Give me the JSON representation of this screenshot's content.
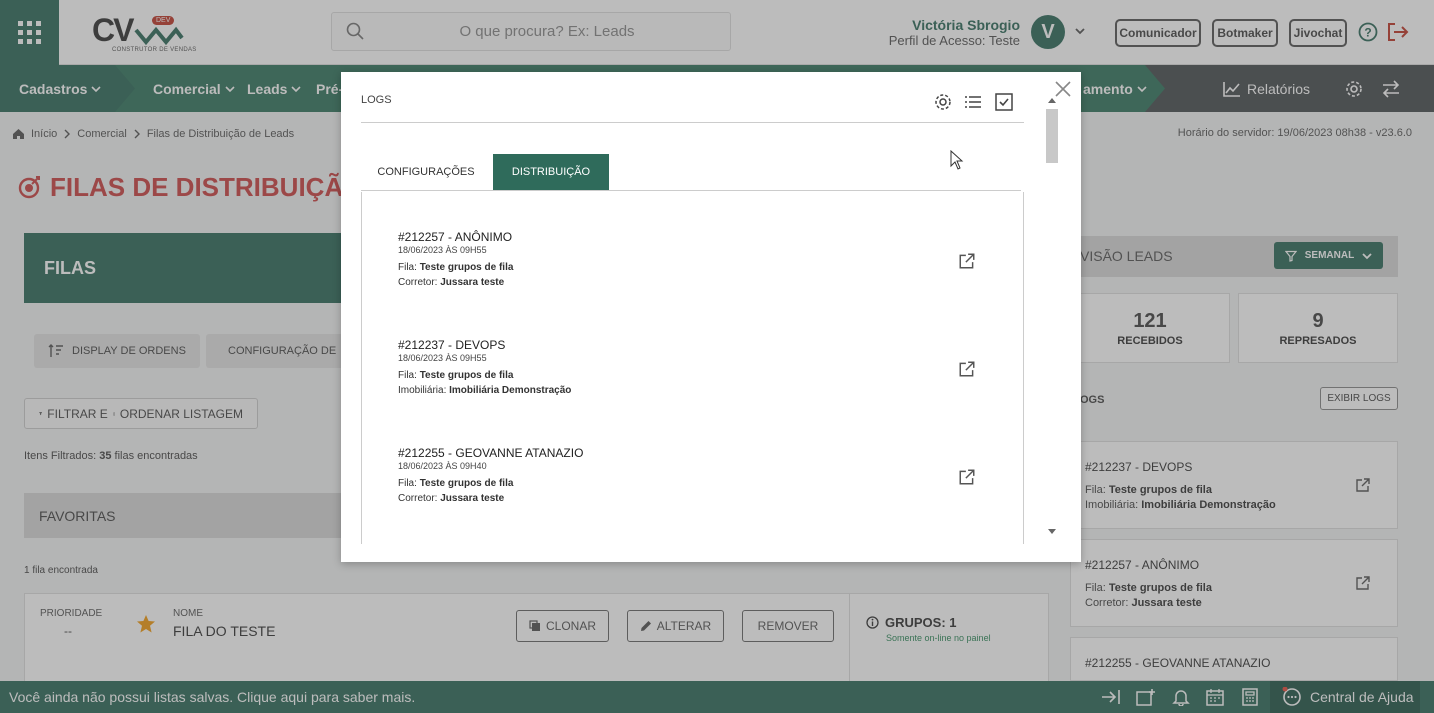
{
  "header": {
    "search_placeholder": "O que procura? Ex: Leads",
    "user_name": "Victória Sbrogio",
    "user_profile": "Perfil de Acesso: Teste",
    "avatar_letter": "V",
    "logo_text": "CV",
    "logo_badge": "DEV",
    "logo_tagline": "CONSTRUTOR DE VENDAS",
    "buttons": [
      "Comunicador",
      "Botmaker",
      "Jivochat"
    ]
  },
  "nav": {
    "items": [
      "Cadastros",
      "Comercial",
      "Leads",
      "Pré-",
      "amento"
    ],
    "relatorios": "Relatórios"
  },
  "breadcrumb": {
    "items": [
      "Início",
      "Comercial",
      "Filas de Distribuição de Leads"
    ],
    "server_time": "Horário do servidor: 19/06/2023 08h38 - v23.6.0"
  },
  "page": {
    "title": "FILAS DE DISTRIBUIÇÃ",
    "filas_label": "FILAS",
    "display_btn": "DISPLAY DE ORDENS",
    "config_btn": "CONFIGURAÇÃO DE",
    "filter_a": "FILTRAR E",
    "filter_b": "ORDENAR LISTAGEM",
    "items_prefix": "Itens Filtrados:",
    "items_count": "35",
    "items_suffix": "filas encontradas",
    "favoritas": "FAVORITAS",
    "one_found": "1 fila encontrada",
    "card": {
      "prioridade_label": "PRIORIDADE",
      "prioridade_value": "--",
      "nome_label": "NOME",
      "nome_value": "FILA DO TESTE",
      "clonar": "CLONAR",
      "alterar": "ALTERAR",
      "remover": "REMOVER",
      "grupos": "GRUPOS: 1",
      "grupos_sub": "Somente on-line no painel"
    }
  },
  "right_panel": {
    "visao": "VISÃO LEADS",
    "semanal": "SEMANAL",
    "stats": [
      {
        "value": "121",
        "label": "RECEBIDOS"
      },
      {
        "value": "9",
        "label": "REPRESADOS"
      }
    ],
    "logs_label": "OGS",
    "exibir_logs": "EXIBIR LOGS",
    "logs": [
      {
        "title": "#212237 - DEVOPS",
        "l1_label": "Fila:",
        "l1_value": "Teste grupos de fila",
        "l2_label": "Imobiliária:",
        "l2_value": "Imobiliária Demonstração"
      },
      {
        "title": "#212257 - ANÔNIMO",
        "l1_label": "Fila:",
        "l1_value": "Teste grupos de fila",
        "l2_label": "Corretor:",
        "l2_value": "Jussara teste"
      },
      {
        "title": "#212255 - GEOVANNE ATANAZIO"
      }
    ]
  },
  "footer": {
    "message": "Você ainda não possui listas salvas. Clique aqui para saber mais.",
    "help": "Central de Ajuda"
  },
  "modal": {
    "title": "LOGS",
    "tabs": [
      "CONFIGURAÇÕES",
      "DISTRIBUIÇÃO"
    ],
    "logs": [
      {
        "title": "#212257 - ANÔNIMO",
        "date": "18/06/2023 ÀS 09H55",
        "l1_label": "Fila:",
        "l1_value": "Teste grupos de fila",
        "l2_label": "Corretor:",
        "l2_value": "Jussara teste"
      },
      {
        "title": "#212237 - DEVOPS",
        "date": "18/06/2023 ÀS 09H55",
        "l1_label": "Fila:",
        "l1_value": "Teste grupos de fila",
        "l2_label": "Imobiliária:",
        "l2_value": "Imobiliária Demonstração"
      },
      {
        "title": "#212255 - GEOVANNE ATANAZIO",
        "date": "18/06/2023 ÀS 09H40",
        "l1_label": "Fila:",
        "l1_value": "Teste grupos de fila",
        "l2_label": "Corretor:",
        "l2_value": "Jussara teste"
      }
    ]
  },
  "colors": {
    "primary": "#2f6b5b",
    "nav": "#35765f",
    "accent_red": "#c44",
    "star": "#f39c12"
  }
}
